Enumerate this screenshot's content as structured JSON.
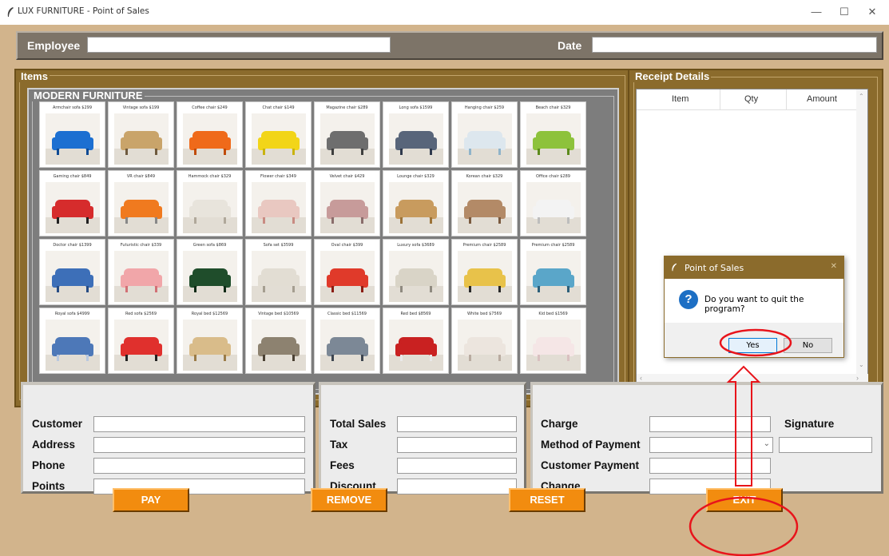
{
  "window": {
    "title": "LUX FURNITURE - Point of Sales",
    "min": "—",
    "max": "☐",
    "close": "✕"
  },
  "header": {
    "employee_label": "Employee",
    "employee_value": "",
    "date_label": "Date",
    "date_value": ""
  },
  "items_section": {
    "title": "Items",
    "category_title": "MODERN FURNITURE"
  },
  "products": [
    {
      "name": "Armchair sofa",
      "price": "$299"
    },
    {
      "name": "Vintage sofa",
      "price": "$199"
    },
    {
      "name": "Coffee chair",
      "price": "$249"
    },
    {
      "name": "Chat chair",
      "price": "$149"
    },
    {
      "name": "Magazine chair",
      "price": "$289"
    },
    {
      "name": "Long sofa",
      "price": "$1599"
    },
    {
      "name": "Hanging chair",
      "price": "$259"
    },
    {
      "name": "Beach chair",
      "price": "$329"
    },
    {
      "name": "Gaming chair",
      "price": "$849"
    },
    {
      "name": "VR chair",
      "price": "$849"
    },
    {
      "name": "Hammock chair",
      "price": "$329"
    },
    {
      "name": "Flower chair",
      "price": "$349"
    },
    {
      "name": "Velvet chair",
      "price": "$429"
    },
    {
      "name": "Lounge chair",
      "price": "$329"
    },
    {
      "name": "Korean chair",
      "price": "$329"
    },
    {
      "name": "Office chair",
      "price": "$289"
    },
    {
      "name": "Doctor chair",
      "price": "$1399"
    },
    {
      "name": "Futuristic chair",
      "price": "$339"
    },
    {
      "name": "Green sofa",
      "price": "$869"
    },
    {
      "name": "Sofa set",
      "price": "$3599"
    },
    {
      "name": "Oval chair",
      "price": "$399"
    },
    {
      "name": "Luxury sofa",
      "price": "$3689"
    },
    {
      "name": "Premium chair",
      "price": "$2589"
    },
    {
      "name": "Premium chair",
      "price": "$2589"
    },
    {
      "name": "Royal sofa",
      "price": "$4999"
    },
    {
      "name": "Red sofa",
      "price": "$2569"
    },
    {
      "name": "Royal bed",
      "price": "$12569"
    },
    {
      "name": "Vintage bed",
      "price": "$10569"
    },
    {
      "name": "Classic bed",
      "price": "$11569"
    },
    {
      "name": "Red bed",
      "price": "$8569"
    },
    {
      "name": "White bed",
      "price": "$7569"
    },
    {
      "name": "Kid bed",
      "price": "$1569"
    }
  ],
  "receipt": {
    "title": "Receipt Details",
    "columns": [
      "Item",
      "Qty",
      "Amount"
    ]
  },
  "customer_panel": {
    "customer": "Customer",
    "address": "Address",
    "phone": "Phone",
    "points": "Points"
  },
  "sales_panel": {
    "total_sales": "Total Sales",
    "tax": "Tax",
    "fees": "Fees",
    "discount": "Discount"
  },
  "payment_panel": {
    "charge": "Charge",
    "method": "Method of Payment",
    "customer_payment": "Customer Payment",
    "change": "Change",
    "signature": "Signature"
  },
  "buttons": {
    "pay": "PAY",
    "remove": "REMOVE",
    "reset": "RESET",
    "exit": "EXIT"
  },
  "dialog": {
    "title": "Point of Sales",
    "message": "Do you want to quit the program?",
    "yes": "Yes",
    "no": "No",
    "close": "✕"
  },
  "colors": {
    "frame_brown": "#8b6b2c",
    "background_tan": "#d2b48c",
    "button_orange": "#f28c0f",
    "annotation_red": "#e8141b"
  }
}
